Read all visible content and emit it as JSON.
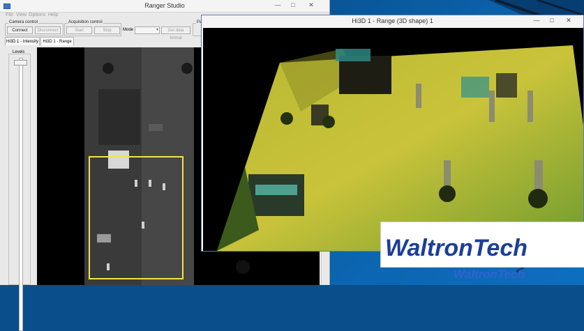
{
  "desktop": {
    "background": "#0b5fa6"
  },
  "main_window": {
    "title": "Ranger Studio",
    "controls": {
      "minimize": "—",
      "maximize": "□",
      "close": "✕"
    },
    "menu": [
      "File",
      "View",
      "Options",
      "Help"
    ],
    "groups": {
      "camera": "Camera control",
      "acquisition": "Acquisition control",
      "partial": "Par"
    },
    "buttons": {
      "connect": "Connect",
      "disconnect": "Disconnect",
      "start": "Start",
      "stop": "Stop",
      "get_data_format": "Get data format"
    },
    "mode_label": "Mode",
    "mode_value": "",
    "tabs": [
      "Hi3D 1 - Intensity",
      "Hi3D 1 - Range"
    ],
    "levels_label": "Levels"
  },
  "range_window": {
    "title": "Hi3D 1 - Range (3D shape) 1",
    "controls": {
      "minimize": "—",
      "maximize": "□",
      "close": "✕"
    }
  },
  "watermark": {
    "main": "WaltronTech",
    "sub": "WaltronTech"
  },
  "colors": {
    "selection": "#f2e34a",
    "accent": "#3b76c4"
  }
}
